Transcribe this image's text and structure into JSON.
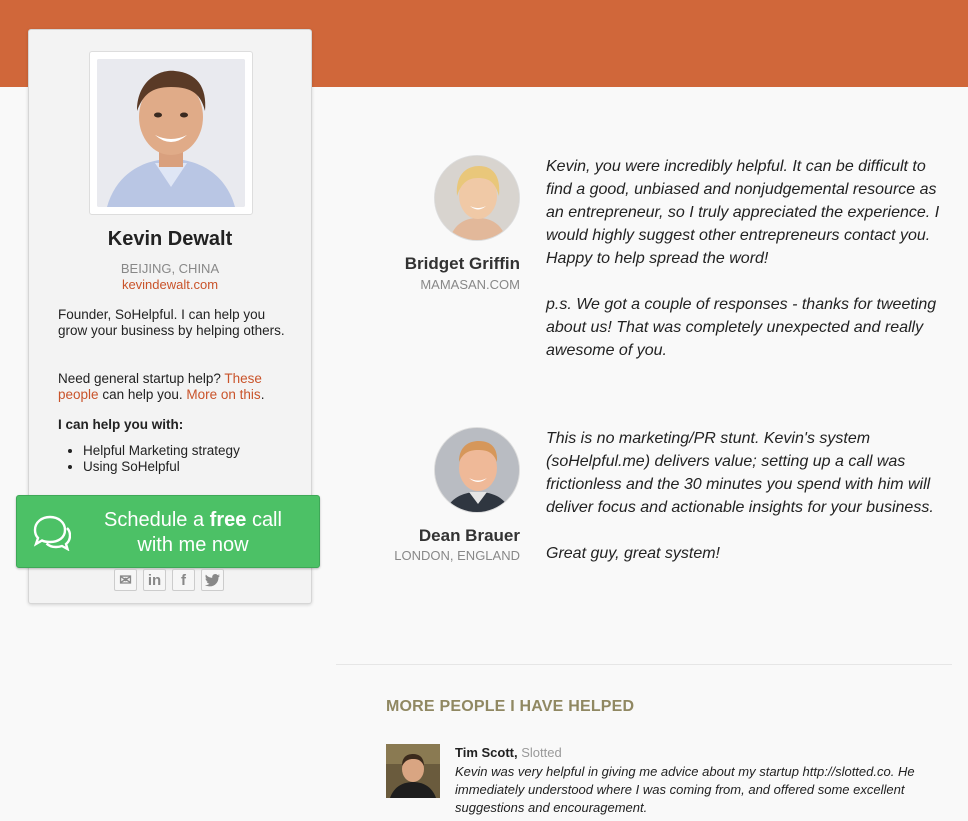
{
  "profile": {
    "name": "Kevin Dewalt",
    "location": "BEIJING, CHINA",
    "website": "kevindewalt.com",
    "bio": "Founder, SoHelpful. I can help you grow your business by helping others.",
    "help_prefix": "Need general startup help?",
    "help_link_1": "These people",
    "help_middle": "can help you.",
    "help_link_2": "More on this",
    "help_suffix": ".",
    "help_heading": "I can help you with:",
    "help_items": [
      "Helpful Marketing strategy",
      "Using SoHelpful"
    ]
  },
  "cta": {
    "text_before": "Schedule a",
    "text_bold": "free",
    "text_after": "call",
    "text_line2": "with me now",
    "icon": "speech-bubbles-icon"
  },
  "social": [
    {
      "name": "email-icon",
      "glyph": "✉"
    },
    {
      "name": "linkedin-icon",
      "glyph": "in"
    },
    {
      "name": "facebook-icon",
      "glyph": "f"
    },
    {
      "name": "twitter-icon",
      "glyph": "🐦"
    }
  ],
  "testimonials": [
    {
      "name": "Bridget Griffin",
      "subtitle": "MAMASAN.COM",
      "paragraph1": "Kevin, you were incredibly helpful. It can be difficult to find a good, unbiased and nonjudgemental resource as an entrepreneur, so I truly appreciated the experience. I would highly suggest other entrepreneurs contact you. Happy to help spread the word!",
      "paragraph2": "p.s. We got a couple of responses - thanks for tweeting about us! That was completely unexpected and really awesome of you."
    },
    {
      "name": "Dean Brauer",
      "subtitle": "LONDON, ENGLAND",
      "paragraph1": "This is no marketing/PR stunt. Kevin's system (soHelpful.me) delivers value; setting up a call was frictionless and the 30 minutes you spend with him will deliver focus and actionable insights for your business.",
      "paragraph2": "Great guy, great system!"
    }
  ],
  "more_people": {
    "heading": "MORE PEOPLE I HAVE HELPED",
    "items": [
      {
        "name": "Tim Scott,",
        "company": "Slotted",
        "text": "Kevin was very helpful in giving me advice about my startup http://slotted.co. He immediately understood where I was coming from, and offered some excellent suggestions and encouragement."
      }
    ]
  },
  "colors": {
    "brand": "#d0673a",
    "link": "#c9532a",
    "cta": "#4cc166",
    "heading_muted": "#908862"
  }
}
